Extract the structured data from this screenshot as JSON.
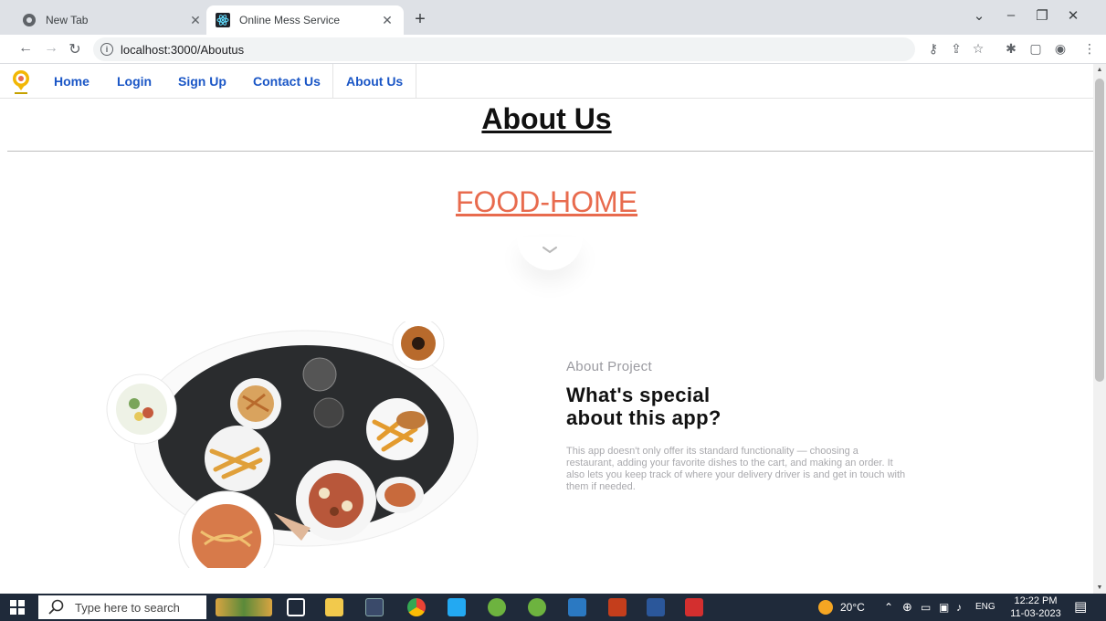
{
  "browser": {
    "tabs": [
      {
        "title": "New Tab",
        "active": false
      },
      {
        "title": "Online Mess Service",
        "active": true
      }
    ],
    "url": "localhost:3000/Aboutus"
  },
  "site": {
    "nav": [
      {
        "label": "Home"
      },
      {
        "label": "Login"
      },
      {
        "label": "Sign Up"
      },
      {
        "label": "Contact Us"
      },
      {
        "label": "About Us",
        "active": true
      }
    ],
    "page_title": "About Us",
    "brand": "FOOD-HOME",
    "about": {
      "eyebrow": "About Project",
      "headline_line1": "What's special",
      "headline_line2": "about this app?",
      "body": "This app doesn't only offer its standard functionality — choosing a restaurant, adding your favorite dishes to the cart, and making an order. It also lets you keep track of where your delivery driver is and get in touch with them if needed."
    },
    "accent_color": "#e86b4e",
    "link_color": "#1a56c6"
  },
  "taskbar": {
    "search_placeholder": "Type here to search",
    "weather": "20°C",
    "language": "ENG",
    "time": "12:22 PM",
    "date": "11-03-2023"
  }
}
